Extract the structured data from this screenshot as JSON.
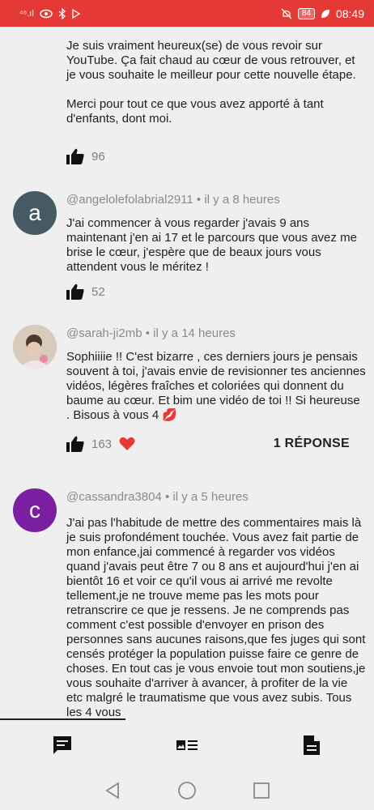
{
  "status_bar": {
    "left_text": "⁴⁶.ıl",
    "battery": "84",
    "time": "08:49"
  },
  "comments": [
    {
      "body": "Je suis vraiment heureux(se) de vous revoir sur YouTube. Ça fait chaud au cœur de vous retrouver, et je vous souhaite le meilleur pour cette nouvelle étape.\n\nMerci pour tout ce que vous avez apporté à tant d'enfants, dont moi.",
      "likes": "96"
    },
    {
      "avatar_letter": "a",
      "author": "@angelolefolabrial2911",
      "time": "• il y a 8 heures",
      "body": "J'ai commencer à vous regarder j'avais 9 ans maintenant j'en ai 17 et le parcours que vous avez me brise le cœur, j'espère que de beaux jours vous attendent vous le méritez !",
      "likes": "52"
    },
    {
      "author": "@sarah-ji2mb",
      "time": "• il y a 14 heures",
      "body": "Sophiiiie !! C'est bizarre , ces derniers jours je pensais souvent à toi, j'avais envie de revisionner tes anciennes vidéos, légères fraîches et coloriées qui donnent du baume au cœur. Et bim une vidéo de toi !! Si heureuse . Bisous à vous 4 💋",
      "likes": "163",
      "reply_label": "1 RÉPONSE"
    },
    {
      "avatar_letter": "c",
      "author": "@cassandra3804",
      "time": "• il y a 5 heures",
      "body": "J'ai pas l'habitude de mettre des commentaires mais là je suis profondément touchée. Vous avez fait partie de mon enfance,jai commencé à regarder vos vidéos quand j'avais peut être 7 ou 8 ans et aujourd'hui j'en ai bientôt 16 et voir ce qu'il vous ai arrivé me revolte tellement,je ne trouve meme pas les mots pour retranscrire ce que je ressens. Je ne comprends pas comment c'est possible d'envoyer en prison des personnes sans aucunes raisons,que fes juges qui sont censés protéger la population puisse faire ce genre de choses. En tout cas je vous envoie tout mon soutiens,je vous souhaite d'arriver à avancer, à profiter de la vie etc malgré le traumatisme que vous avez subis. Tous les 4 vous"
    }
  ],
  "colors": {
    "status_bar": "#e53935",
    "avatar_a": "#455a64",
    "avatar_c": "#7b1fa2",
    "heart": "#e53935"
  },
  "icons": {
    "tabs": [
      "comment-icon",
      "description-icon",
      "document-icon"
    ],
    "nav": [
      "back-icon",
      "home-icon",
      "recents-icon"
    ]
  }
}
